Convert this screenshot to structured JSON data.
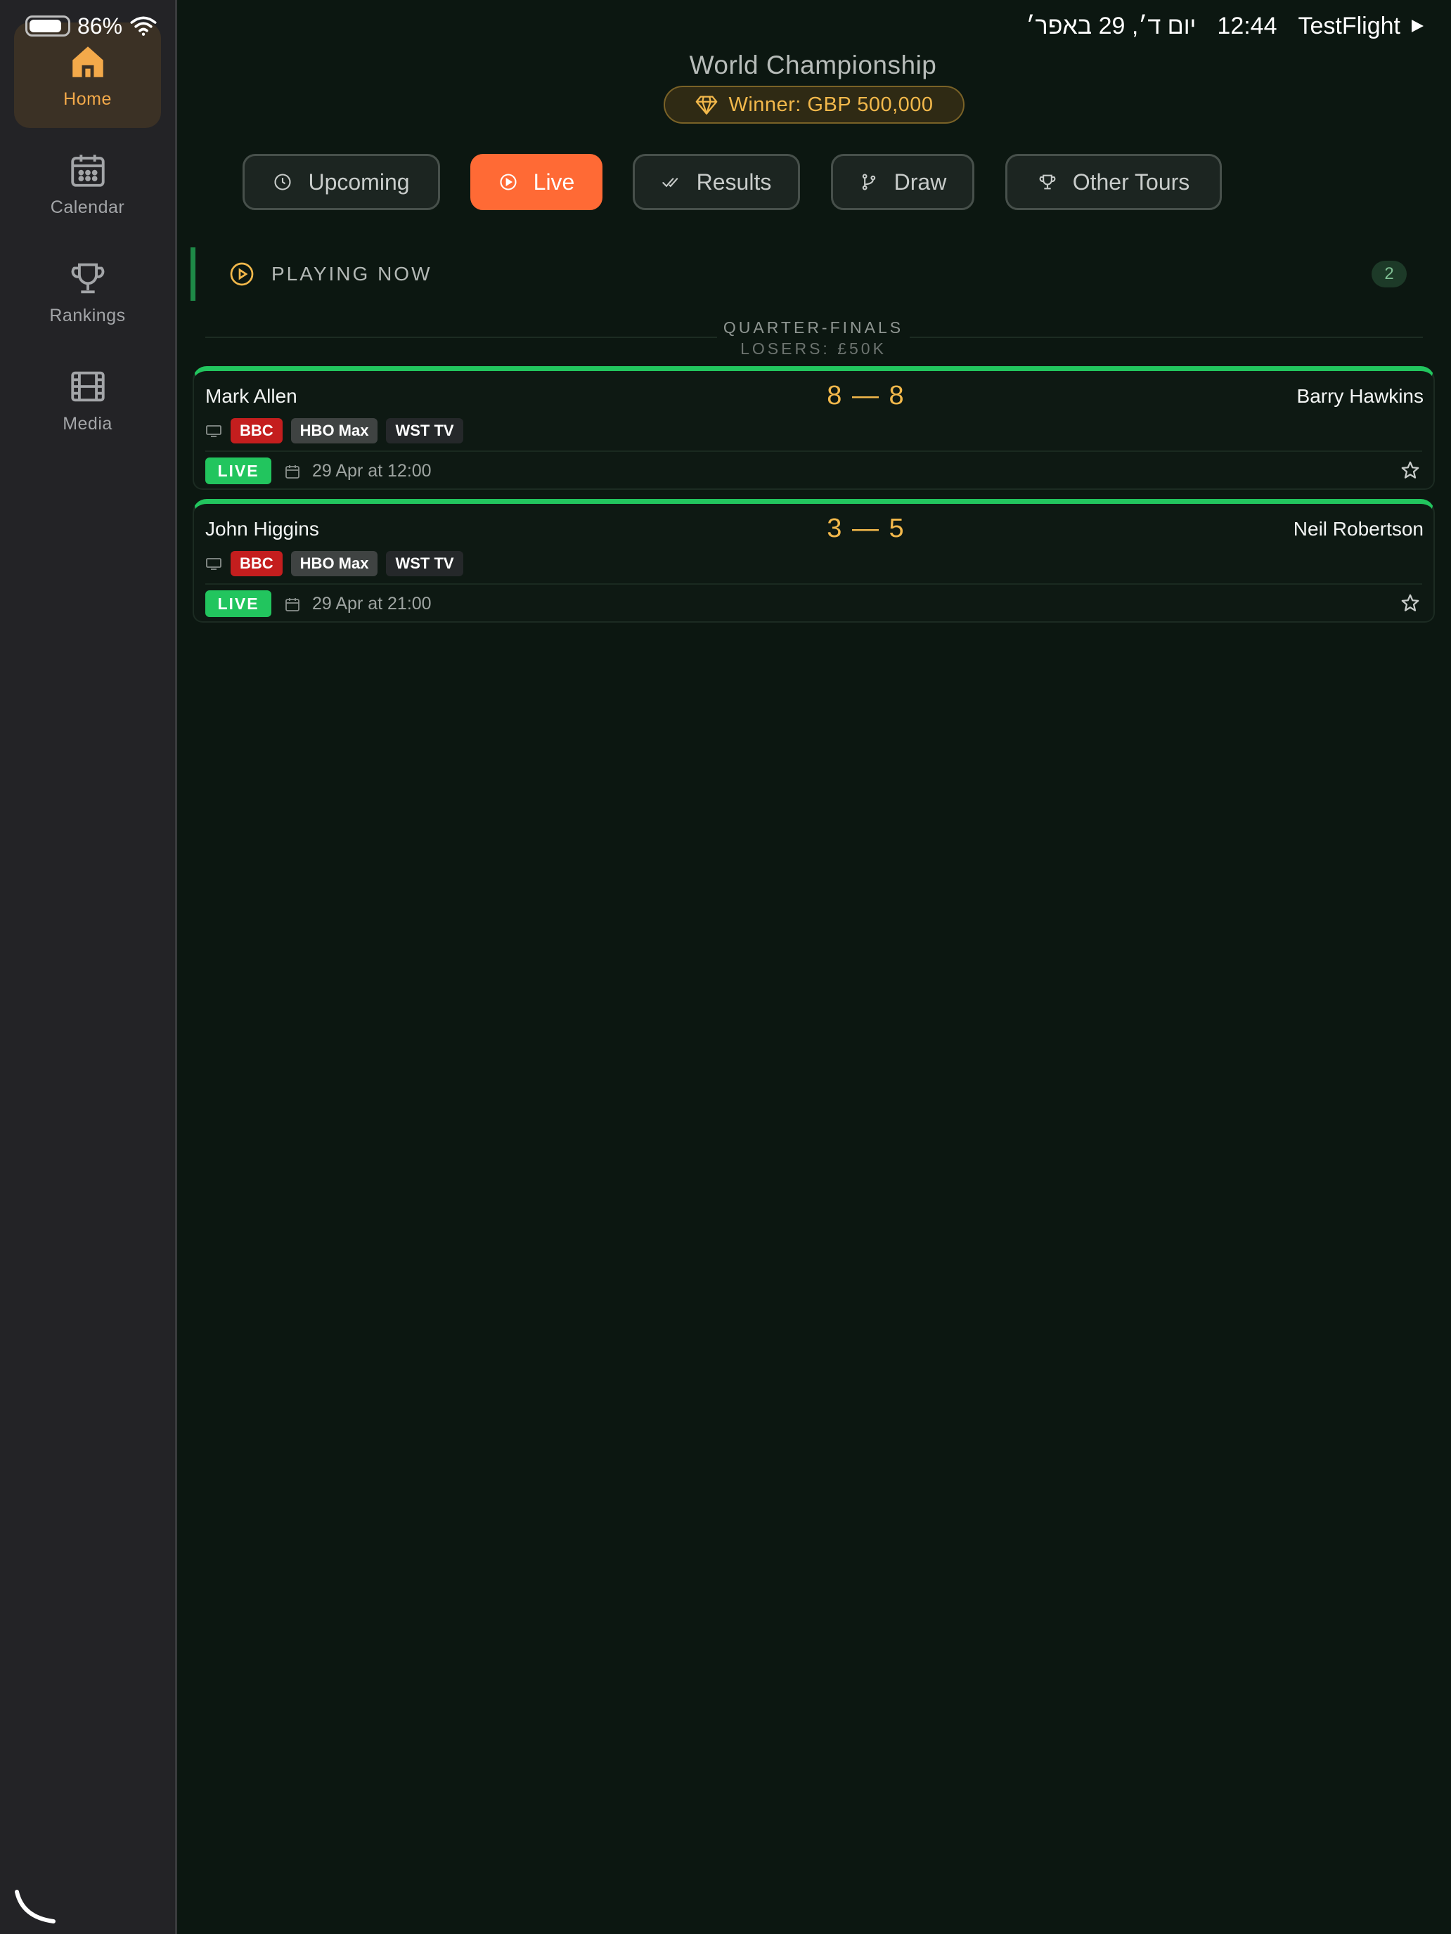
{
  "status_bar": {
    "battery_percent": "86%",
    "battery_level": 0.86,
    "time": "12:44",
    "date": "יום ד׳, 29 באפר׳",
    "back_app": "TestFlight"
  },
  "sidebar": {
    "items": [
      {
        "label": "Home",
        "icon": "home-icon",
        "active": true
      },
      {
        "label": "Calendar",
        "icon": "calendar-icon",
        "active": false
      },
      {
        "label": "Rankings",
        "icon": "trophy-icon",
        "active": false
      },
      {
        "label": "Media",
        "icon": "film-icon",
        "active": false
      }
    ]
  },
  "header": {
    "title": "World Championship",
    "prize": "Winner: GBP 500,000"
  },
  "tabs": [
    {
      "label": "Upcoming",
      "icon": "clock-icon",
      "active": false
    },
    {
      "label": "Live",
      "icon": "play-circle-icon",
      "active": true
    },
    {
      "label": "Results",
      "icon": "double-check-icon",
      "active": false
    },
    {
      "label": "Draw",
      "icon": "branch-icon",
      "active": false
    },
    {
      "label": "Other Tours",
      "icon": "trophy-icon",
      "active": false
    }
  ],
  "section": {
    "title": "PLAYING NOW",
    "count": "2"
  },
  "round": {
    "name": "QUARTER-FINALS",
    "losers": "LOSERS: £50K"
  },
  "matches": [
    {
      "player1": "Mark Allen",
      "player2": "Barry Hawkins",
      "score": "8 — 8",
      "broadcasters": [
        "BBC",
        "HBO Max",
        "WST TV"
      ],
      "status": "LIVE",
      "datetime": "29 Apr at 12:00"
    },
    {
      "player1": "John Higgins",
      "player2": "Neil Robertson",
      "score": "3 — 5",
      "broadcasters": [
        "BBC",
        "HBO Max",
        "WST TV"
      ],
      "status": "LIVE",
      "datetime": "29 Apr at 21:00"
    }
  ],
  "colors": {
    "accent_orange": "#ff6a35",
    "live_green": "#22c55e",
    "gold": "#f2b84b",
    "background": "#0c1711"
  }
}
